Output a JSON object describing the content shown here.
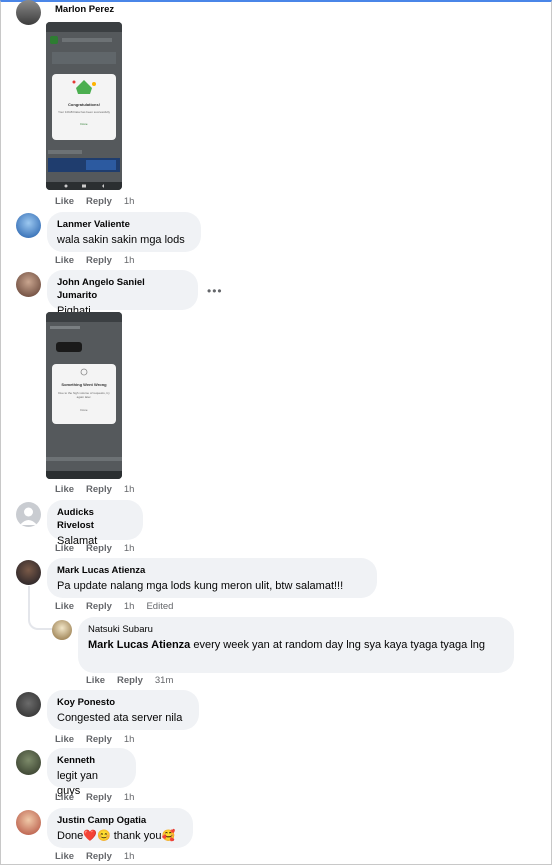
{
  "comments": [
    {
      "name": "Marlon Perez",
      "text": "",
      "like": "Like",
      "reply": "Reply",
      "time": "1h"
    },
    {
      "name": "Lanmer Valiente",
      "text": "wala sakin sakin mga lods",
      "like": "Like",
      "reply": "Reply",
      "time": "1h"
    },
    {
      "name": "John Angelo Saniel Jumarito",
      "text": "Pighati",
      "like": "Like",
      "reply": "Reply",
      "time": "1h"
    },
    {
      "name": "Audicks Rivelost",
      "text": "Salamat",
      "like": "Like",
      "reply": "Reply",
      "time": "1h"
    },
    {
      "name": "Mark Lucas Atienza",
      "text": "Pa update nalang mga lods kung meron ulit, btw salamat!!!",
      "like": "Like",
      "reply": "Reply",
      "time": "1h",
      "edited": "Edited"
    },
    {
      "name": "Koy Ponesto",
      "text": "Congested ata server nila",
      "like": "Like",
      "reply": "Reply",
      "time": "1h"
    },
    {
      "name": "Kenneth",
      "text": "legit yan guys",
      "like": "Like",
      "reply": "Reply",
      "time": "1h"
    },
    {
      "name": "Justin Camp Ogatia",
      "text": "Done❤️😊 thank you🥰",
      "like": "Like",
      "reply": "Reply",
      "time": "1h"
    }
  ],
  "reply": {
    "name": "Natsuki Subaru",
    "mention": "Mark Lucas Atienza",
    "text": " every week yan at random day lng sya kaya tyaga tyaga lng",
    "like": "Like",
    "reply": "Reply",
    "time": "31m"
  },
  "more_options": "•••",
  "screenshot1": {
    "title": "Congratulations!",
    "body": "Your 10GB Data has been successfully",
    "link": "Done"
  },
  "screenshot2": {
    "title": "Something Went Wrong",
    "body": "Due to the high volume of requests, try again later.",
    "link": "Done"
  }
}
